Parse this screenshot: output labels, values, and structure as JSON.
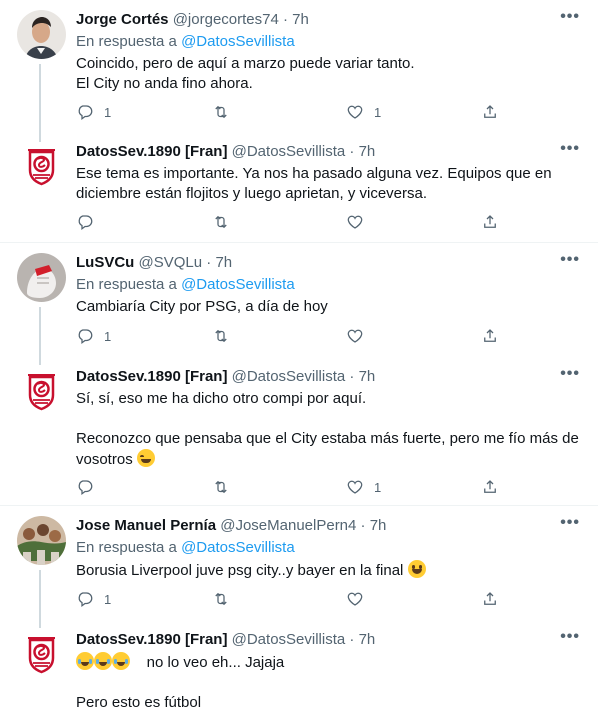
{
  "icons": {
    "reply": "reply-icon",
    "retweet": "retweet-icon",
    "like": "heart-icon",
    "share": "share-icon",
    "more": "more-options-icon"
  },
  "colors": {
    "accent": "#1d9bf0",
    "muted": "#536471",
    "text": "#0f1419",
    "crest_red": "#c8102e"
  },
  "tweets": [
    {
      "name": "Jorge Cortés",
      "handle": "@jorgecortes74",
      "dot": "·",
      "time": "7h",
      "reply_prefix": "En respuesta a",
      "reply_to": "@DatosSevillista",
      "lines": [
        "Coincido, pero de aquí a marzo puede variar tanto.",
        "El City no anda fino ahora."
      ],
      "counts": {
        "reply": "1",
        "retweet": "",
        "like": "1",
        "share": ""
      }
    },
    {
      "name": "DatosSev.1890 [Fran]",
      "handle": "@DatosSevillista",
      "dot": "·",
      "time": "7h",
      "lines": [
        "Ese tema es importante.  Ya nos ha pasado alguna vez.  Equipos que en",
        "diciembre están flojitos y luego aprietan, y viceversa."
      ],
      "counts": {
        "reply": "",
        "retweet": "",
        "like": "",
        "share": ""
      }
    },
    {
      "name": "LuSVCu",
      "handle": "@SVQLu",
      "dot": "·",
      "time": "7h",
      "reply_prefix": "En respuesta a",
      "reply_to": "@DatosSevillista",
      "lines": [
        "Cambiaría City por PSG, a día de hoy"
      ],
      "counts": {
        "reply": "1",
        "retweet": "",
        "like": "",
        "share": ""
      }
    },
    {
      "name": "DatosSev.1890 [Fran]",
      "handle": "@DatosSevillista",
      "dot": "·",
      "time": "7h",
      "lines": [
        "Sí, sí, eso me ha dicho otro compi por aquí.",
        "",
        "Reconozco que pensaba que el City estaba más fuerte, pero me fío más de",
        "vosotros"
      ],
      "counts": {
        "reply": "",
        "retweet": "",
        "like": "1",
        "share": ""
      }
    },
    {
      "name": "Jose Manuel Pernía",
      "handle": "@JoseManuelPern4",
      "dot": "·",
      "time": "7h",
      "reply_prefix": "En respuesta a",
      "reply_to": "@DatosSevillista",
      "lines": [
        "Borusia Liverpool juve psg city..y bayer en la final"
      ],
      "counts": {
        "reply": "1",
        "retweet": "",
        "like": "",
        "share": ""
      }
    },
    {
      "name": "DatosSev.1890 [Fran]",
      "handle": "@DatosSevillista",
      "dot": "·",
      "time": "7h",
      "lines": [
        "no lo veo eh... Jajaja",
        "",
        "Pero esto es fútbol"
      ],
      "counts": {
        "reply": "",
        "retweet": "",
        "like": "",
        "share": ""
      }
    }
  ]
}
